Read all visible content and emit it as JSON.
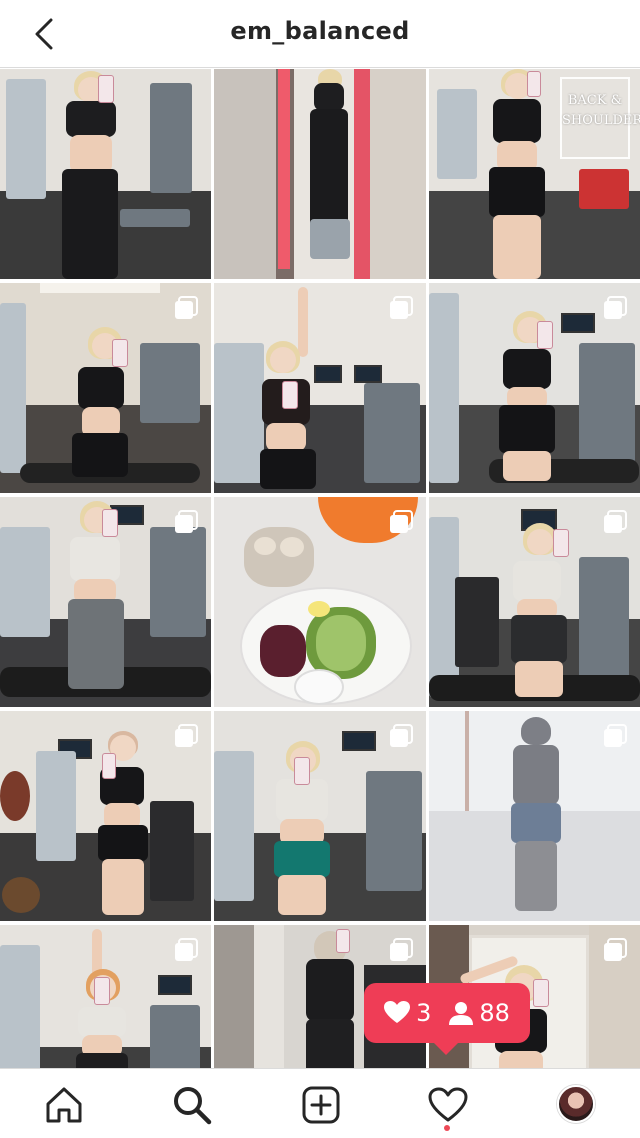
{
  "header": {
    "title": "em_balanced",
    "back_icon": "chevron-left-icon"
  },
  "grid": {
    "tiles": [
      {
        "multi": false,
        "scene": "gym-selfie"
      },
      {
        "multi": false,
        "scene": "mirror-selfie"
      },
      {
        "multi": false,
        "scene": "gym-selfie",
        "overlay": "BACK &\nSHOULDERS"
      },
      {
        "multi": true,
        "scene": "gym-selfie"
      },
      {
        "multi": true,
        "scene": "gym-selfie"
      },
      {
        "multi": true,
        "scene": "gym-selfie"
      },
      {
        "multi": true,
        "scene": "gym-selfie"
      },
      {
        "multi": true,
        "scene": "food"
      },
      {
        "multi": true,
        "scene": "gym-selfie"
      },
      {
        "multi": true,
        "scene": "gym-selfie"
      },
      {
        "multi": true,
        "scene": "gym-selfie"
      },
      {
        "multi": true,
        "scene": "faded-street"
      },
      {
        "multi": true,
        "scene": "gym-selfie"
      },
      {
        "multi": true,
        "scene": "mirror-selfie"
      },
      {
        "multi": true,
        "scene": "door-selfie"
      }
    ]
  },
  "notification": {
    "likes": "3",
    "followers": "88",
    "like_icon": "heart-icon",
    "follower_icon": "person-icon",
    "color": "#ef3d56"
  },
  "tabbar": {
    "items": [
      "home-icon",
      "search-icon",
      "new-post-icon",
      "activity-icon",
      "profile-avatar"
    ],
    "active": "search-icon",
    "activity_dot_color": "#ed4956"
  }
}
